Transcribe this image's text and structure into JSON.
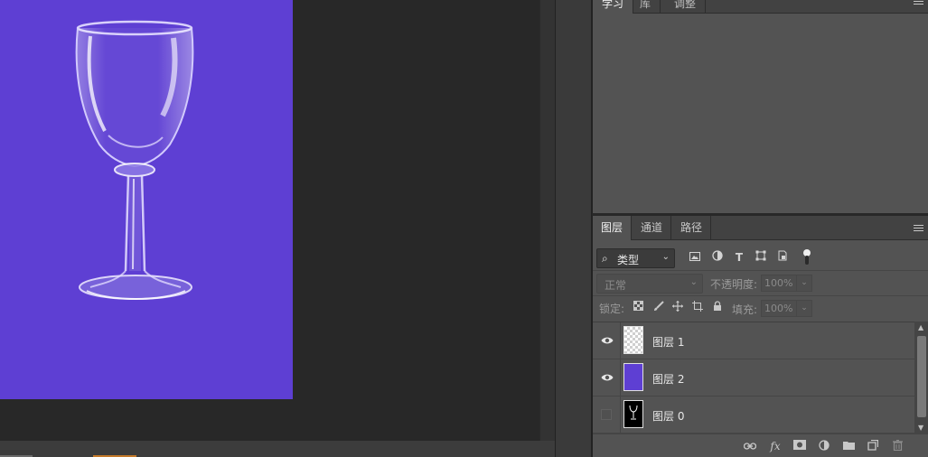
{
  "top_panel": {
    "tabs": [
      {
        "label": "学习",
        "active": true
      },
      {
        "label": "库",
        "active": false
      },
      {
        "label": "调整",
        "active": false
      }
    ]
  },
  "layers_panel": {
    "tabs": [
      {
        "label": "图层",
        "active": true
      },
      {
        "label": "通道",
        "active": false
      },
      {
        "label": "路径",
        "active": false
      }
    ],
    "filter": {
      "kind_label": "类型",
      "icons": [
        "image-filter-icon",
        "adjustment-filter-icon",
        "type-filter-icon",
        "shape-filter-icon",
        "smart-object-filter-icon"
      ]
    },
    "blend_mode": "正常",
    "opacity_label": "不透明度:",
    "opacity_value": "100%",
    "lock_label": "锁定:",
    "fill_label": "填充:",
    "fill_value": "100%",
    "layers": [
      {
        "name": "图层 1",
        "visible": true,
        "thumb": "transparent"
      },
      {
        "name": "图层 2",
        "visible": true,
        "thumb": "purple"
      },
      {
        "name": "图层 0",
        "visible": false,
        "thumb": "glass-mask"
      }
    ],
    "bottom_icons": [
      "link-icon",
      "fx-icon",
      "add-mask-icon",
      "adjustment-layer-icon",
      "new-group-icon",
      "new-layer-icon",
      "trash-icon"
    ],
    "fx_label": "fx"
  },
  "colors": {
    "canvas_fill": "#5e3fd3",
    "panel_bg": "#535353",
    "workspace_bg": "#282828"
  }
}
